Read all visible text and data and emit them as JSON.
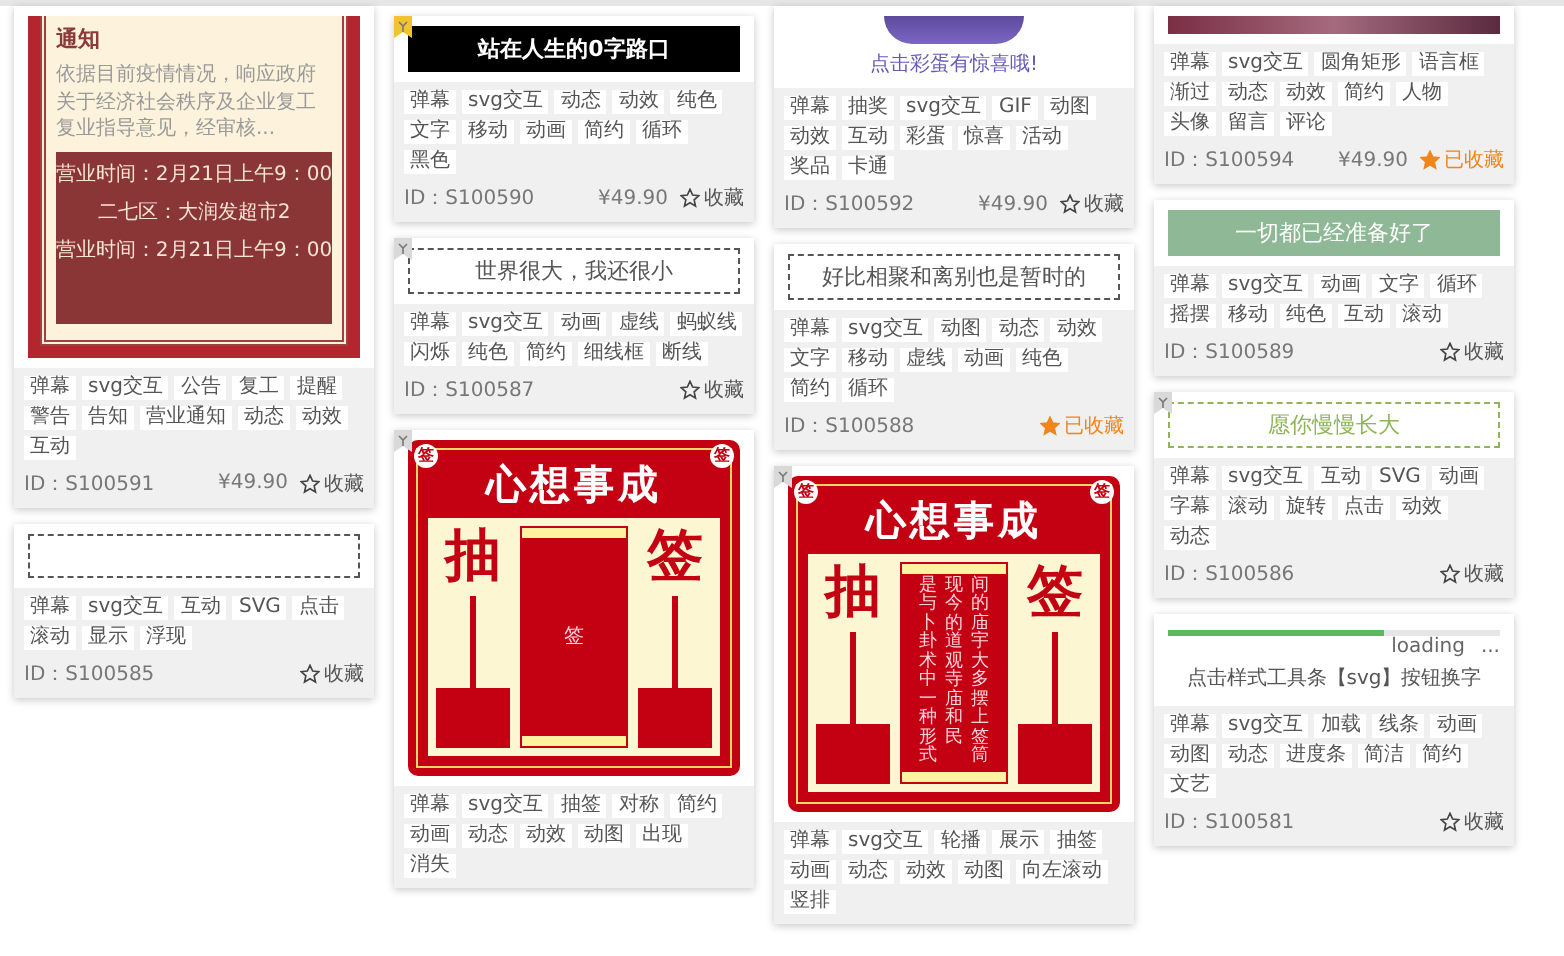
{
  "columns": [
    {
      "cards": [
        {
          "preview": {
            "kind": "notice",
            "title": "通知",
            "body": "依据目前疫情情况，响应政府关于经济社会秩序及企业复工复业指导意见，经审核...",
            "lines": [
              "营业时间：2月21日上午9：00",
              "二七区：大润发超市2",
              "营业时间：2月21日上午9：00"
            ]
          },
          "tags": [
            "弹幕",
            "svg交互",
            "公告",
            "复工",
            "提醒",
            "警告",
            "告知",
            "营业通知",
            "动态",
            "动效",
            "互动"
          ],
          "id": "ID：S100591",
          "price": "¥49.90",
          "favorite": {
            "label": "收藏",
            "on": false
          }
        },
        {
          "preview": {
            "kind": "dashed",
            "color": "#555555"
          },
          "tags": [
            "弹幕",
            "svg交互",
            "互动",
            "SVG",
            "点击",
            "滚动",
            "显示",
            "浮现"
          ],
          "id": "ID：S100585",
          "favorite": {
            "label": "收藏",
            "on": false
          }
        }
      ]
    },
    {
      "cards": [
        {
          "badge": {
            "color": "#f2c230"
          },
          "preview": {
            "kind": "banner",
            "text": "站在人生的0字路口",
            "color": "#000000"
          },
          "tags": [
            "弹幕",
            "svg交互",
            "动态",
            "动效",
            "纯色",
            "文字",
            "移动",
            "动画",
            "简约",
            "循环",
            "黑色"
          ],
          "id": "ID：S100590",
          "price": "¥49.90",
          "favorite": {
            "label": "收藏",
            "on": false
          }
        },
        {
          "badge": {
            "color": "#d9d9d9"
          },
          "preview": {
            "kind": "dashed",
            "text": "世界很大，我还很小",
            "color": "#555555"
          },
          "tags": [
            "弹幕",
            "svg交互",
            "动画",
            "虚线",
            "蚂蚁线",
            "闪烁",
            "纯色",
            "简约",
            "细线框",
            "断线"
          ],
          "id": "ID：S100587",
          "favorite": {
            "label": "收藏",
            "on": false
          }
        },
        {
          "badge": {
            "color": "#d9d9d9"
          },
          "preview": {
            "kind": "lottery",
            "title": "心想事成",
            "left": "抽",
            "right": "签",
            "seals": [
              "签",
              "签"
            ],
            "slip": [
              "签"
            ]
          },
          "tags": [
            "弹幕",
            "svg交互",
            "抽签",
            "对称",
            "简约",
            "动画",
            "动态",
            "动效",
            "动图",
            "出现",
            "消失"
          ]
        }
      ]
    },
    {
      "cards": [
        {
          "preview": {
            "kind": "orb",
            "text": "点击彩蛋有惊喜哦!"
          },
          "tags": [
            "弹幕",
            "抽奖",
            "svg交互",
            "GIF",
            "动图",
            "动效",
            "互动",
            "彩蛋",
            "惊喜",
            "活动",
            "奖品",
            "卡通"
          ],
          "id": "ID：S100592",
          "price": "¥49.90",
          "favorite": {
            "label": "收藏",
            "on": false
          }
        },
        {
          "preview": {
            "kind": "dashed",
            "text": "好比相聚和离别也是暂时的",
            "color": "#555555"
          },
          "tags": [
            "弹幕",
            "svg交互",
            "动图",
            "动态",
            "动效",
            "文字",
            "移动",
            "虚线",
            "动画",
            "纯色",
            "简约",
            "循环"
          ],
          "id": "ID：S100588",
          "favorite": {
            "label": "已收藏",
            "on": true
          }
        },
        {
          "badge": {
            "color": "#d9d9d9"
          },
          "preview": {
            "kind": "lottery",
            "title": "心想事成",
            "left": "抽",
            "right": "签",
            "seals": [
              "签",
              "签"
            ],
            "slip": [
              "是与卜卦术中一种形式",
              "现今的道观寺庙和民",
              "间的庙宇大多摆上签筒"
            ]
          },
          "tags": [
            "弹幕",
            "svg交互",
            "轮播",
            "展示",
            "抽签",
            "动画",
            "动态",
            "动效",
            "动图",
            "向左滚动",
            "竖排"
          ]
        }
      ]
    },
    {
      "cards": [
        {
          "preview": {
            "kind": "photo"
          },
          "tags": [
            "弹幕",
            "svg交互",
            "圆角矩形",
            "语言框",
            "渐过",
            "动态",
            "动效",
            "简约",
            "人物",
            "头像",
            "留言",
            "评论"
          ],
          "id": "ID：S100594",
          "price": "¥49.90",
          "favorite": {
            "label": "已收藏",
            "on": true
          }
        },
        {
          "preview": {
            "kind": "banner",
            "text": "一切都已经准备好了",
            "color": "#8fb996"
          },
          "tags": [
            "弹幕",
            "svg交互",
            "动画",
            "文字",
            "循环",
            "摇摆",
            "移动",
            "纯色",
            "互动",
            "滚动"
          ],
          "id": "ID：S100589",
          "favorite": {
            "label": "收藏",
            "on": false
          }
        },
        {
          "badge": {
            "color": "#d9d9d9"
          },
          "preview": {
            "kind": "dashed",
            "text": "愿你慢慢长大",
            "color": "#8fb45a"
          },
          "tags": [
            "弹幕",
            "svg交互",
            "互动",
            "SVG",
            "动画",
            "字幕",
            "滚动",
            "旋转",
            "点击",
            "动效",
            "动态"
          ],
          "id": "ID：S100586",
          "favorite": {
            "label": "收藏",
            "on": false
          }
        },
        {
          "preview": {
            "kind": "loading",
            "level": 0.65,
            "status": "loading",
            "dots": "...",
            "text": "点击样式工具条【svg】按钮换字"
          },
          "tags": [
            "弹幕",
            "svg交互",
            "加载",
            "线条",
            "动画",
            "动图",
            "动态",
            "进度条",
            "简洁",
            "简约",
            "文艺"
          ],
          "id": "ID：S100581",
          "favorite": {
            "label": "收藏",
            "on": false
          }
        }
      ]
    }
  ]
}
